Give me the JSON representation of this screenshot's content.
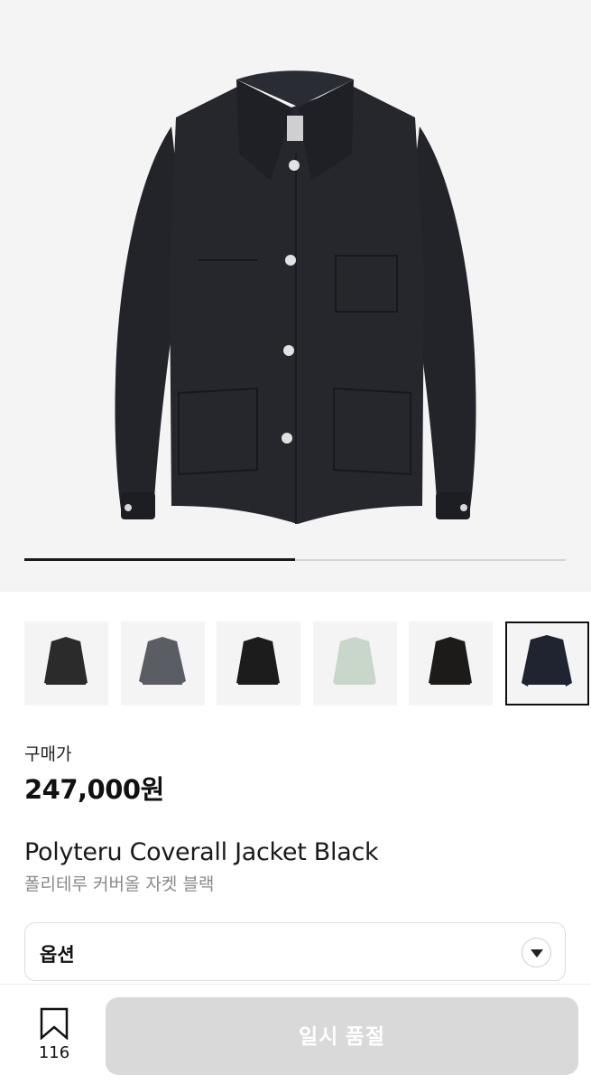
{
  "gallery": {
    "progress": 0.5,
    "main_image_alt": "Black coverall jacket",
    "thumbnails": [
      {
        "color": "#2b2b2b",
        "selected": false
      },
      {
        "color": "#5a5d63",
        "selected": false
      },
      {
        "color": "#1c1c1c",
        "selected": false
      },
      {
        "color": "#c9d7cb",
        "selected": false
      },
      {
        "color": "#1d1b1a",
        "selected": false
      },
      {
        "color": "#1f2430",
        "selected": true
      }
    ]
  },
  "price": {
    "label": "구매가",
    "value": "247,000원"
  },
  "product": {
    "name_en": "Polyteru Coverall Jacket Black",
    "name_ko": "폴리테루 커버올 자켓 블랙"
  },
  "option": {
    "label": "옵션"
  },
  "bottom": {
    "wish_count": "116",
    "button_label": "일시 품절"
  },
  "colors": {
    "jacket": "#23252b",
    "button_disabled": "#d9d9d9"
  }
}
